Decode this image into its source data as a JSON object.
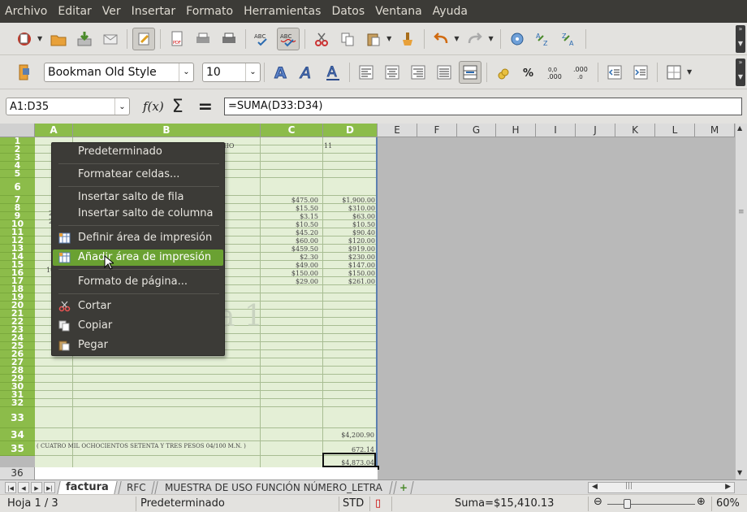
{
  "menubar": {
    "items": [
      "Archivo",
      "Editar",
      "Ver",
      "Insertar",
      "Formato",
      "Herramientas",
      "Datos",
      "Ventana",
      "Ayuda"
    ]
  },
  "toolbar1": {
    "buttons": [
      "new-icon",
      "open-icon",
      "save-icon",
      "email-icon",
      "edit-file-icon",
      "pdf-icon",
      "print-icon",
      "print-direct-icon",
      "spellcheck-icon",
      "autospell-icon",
      "cut-icon",
      "copy-icon",
      "paste-icon",
      "clone-format-icon",
      "undo-icon",
      "redo-icon",
      "navigator-icon",
      "sort-ascending-icon",
      "sort-descending-icon"
    ]
  },
  "toolbar2": {
    "font_name": "Bookman Old Style",
    "font_size": "10",
    "buttons": [
      "bold-icon",
      "italic-icon",
      "underline-icon",
      "align-left-icon",
      "align-center-icon",
      "align-right-icon",
      "justify-icon",
      "merge-cells-icon",
      "currency-icon",
      "percent-icon",
      "add-decimal-icon",
      "remove-decimal-icon",
      "indent-decrease-icon",
      "indent-increase-icon",
      "borders-icon"
    ]
  },
  "formula": {
    "name_box": "A1:D35",
    "fx": "f(x)",
    "sigma": "Σ",
    "equals": "=",
    "content": "=SUMA(D33:D34)"
  },
  "columns": [
    "A",
    "B",
    "C",
    "D",
    "E",
    "F",
    "G",
    "H",
    "I",
    "J",
    "K",
    "L",
    "M"
  ],
  "rows": [
    "1",
    "2",
    "3",
    "4",
    "5",
    "6",
    "7",
    "8",
    "9",
    "10",
    "11",
    "12",
    "13",
    "14",
    "15",
    "16",
    "17",
    "18",
    "19",
    "20",
    "21",
    "22",
    "23",
    "24",
    "25",
    "26",
    "27",
    "28",
    "29",
    "30",
    "31",
    "32",
    "33",
    "34",
    "35"
  ],
  "row36": "36",
  "cells": {
    "b1": "UNIO",
    "d1": "11",
    "prices": [
      "$475.00",
      "$15.50",
      "$3.15",
      "$10.50",
      "$45.20",
      "$60.00",
      "$459.50",
      "$2.30",
      "$49.00",
      "$150.00",
      "$29.00"
    ],
    "totals": [
      "$1,900.00",
      "$310.00",
      "$63.00",
      "$10.50",
      "$90.40",
      "$120.00",
      "$919.00",
      "$230.00",
      "$147.00",
      "$150.00",
      "$261.00"
    ],
    "left_fragments": [
      "2",
      "2",
      "10"
    ],
    "d33": "$4,200.90",
    "a34": "( CUATRO MIL OCHOCIENTOS SETENTA Y TRES PESOS 04/100 M.N. )",
    "d34": "672.14",
    "d35": "$4,873.04",
    "watermark": "a 1"
  },
  "context_menu": {
    "items": [
      {
        "label": "Predeterminado",
        "icon": ""
      },
      {
        "label": "Formatear celdas...",
        "icon": ""
      },
      {
        "label": "Insertar salto de fila",
        "icon": ""
      },
      {
        "label": "Insertar salto de columna",
        "icon": ""
      },
      {
        "label": "Definir área de impresión",
        "icon": "print-range-icon"
      },
      {
        "label": "Añadir área de impresión",
        "icon": "add-print-range-icon"
      },
      {
        "label": "Formato de página...",
        "icon": ""
      },
      {
        "label": "Cortar",
        "icon": "cut-icon"
      },
      {
        "label": "Copiar",
        "icon": "copy-icon"
      },
      {
        "label": "Pegar",
        "icon": "paste-icon"
      }
    ]
  },
  "sheet_tabs": [
    "factura",
    "RFC",
    "MUESTRA DE USO FUNCIÓN NÚMERO_LETRA"
  ],
  "status": {
    "page": "Hoja 1 / 3",
    "style": "Predeterminado",
    "mode": "STD",
    "sum": "Suma=$15,410.13",
    "zoom": "60%"
  },
  "colors": {
    "accent": "#8cbc4a",
    "menu_bg": "#3c3b37",
    "menu_highlight": "#6aa132",
    "page_bg": "#e4efd6"
  }
}
